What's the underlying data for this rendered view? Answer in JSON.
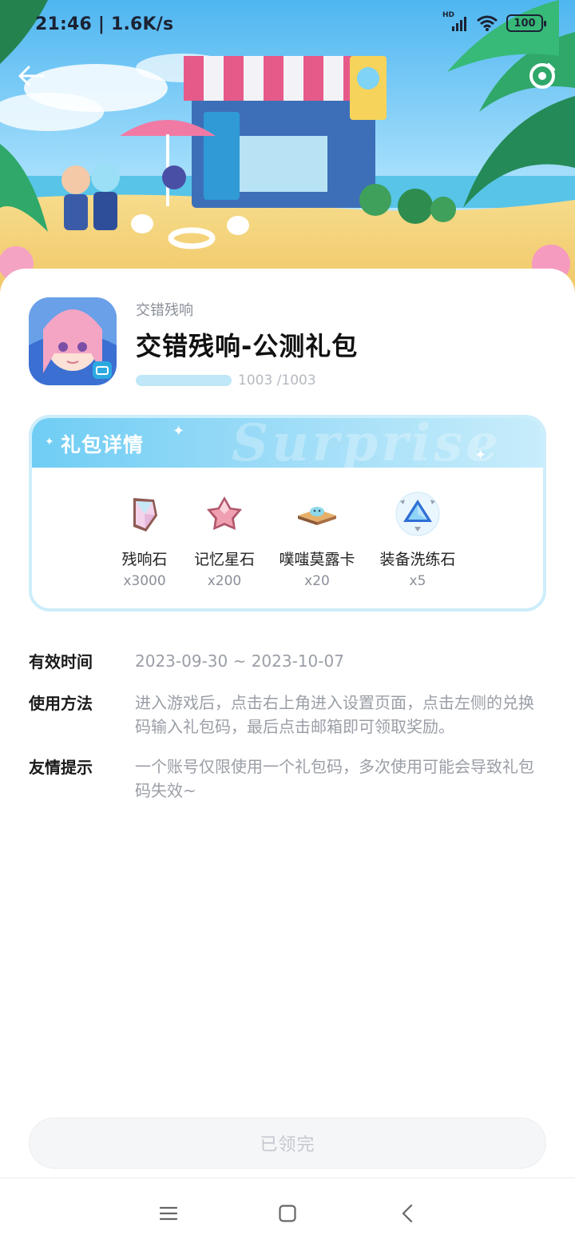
{
  "status_bar": {
    "time": "21:46 | 1.6K/s",
    "network": "HD",
    "battery": "100",
    "network_icon": "signal-icon",
    "wifi_icon": "wifi-icon"
  },
  "header": {
    "back_icon": "back-arrow-icon",
    "settings_icon": "settings-icon"
  },
  "gift": {
    "game_name": "交错残响",
    "title": "交错残响-公测礼包",
    "claimed_fraction": 1.0,
    "progress_text": "1003 /1003"
  },
  "details": {
    "title": "礼包详情",
    "watermark": "Surprise",
    "items": [
      {
        "label": "残响石",
        "qty": "x3000",
        "icon": "crystal-icon"
      },
      {
        "label": "记忆星石",
        "qty": "x200",
        "icon": "star-stone-icon"
      },
      {
        "label": "噗嗤莫露卡",
        "qty": "x20",
        "icon": "food-card-icon"
      },
      {
        "label": "装备洗练石",
        "qty": "x5",
        "icon": "refine-stone-icon"
      }
    ]
  },
  "info": {
    "validity_label": "有效时间",
    "validity_value": "2023-09-30 ~ 2023-10-07",
    "usage_label": "使用方法",
    "usage_value": "进入游戏后，点击右上角进入设置页面，点击左侧的兑换码输入礼包码，最后点击邮箱即可领取奖励。",
    "tips_label": "友情提示",
    "tips_value": "一个账号仅限使用一个礼包码，多次使用可能会导致礼包码失效~"
  },
  "claim_button": {
    "label": "已领完"
  },
  "nav": {
    "menu_icon": "menu-icon",
    "home_icon": "home-icon",
    "back_icon": "back-icon"
  },
  "colors": {
    "accent": "#6fcdf4",
    "card_border": "#cdeefb",
    "muted_text": "#9a9ea6"
  }
}
